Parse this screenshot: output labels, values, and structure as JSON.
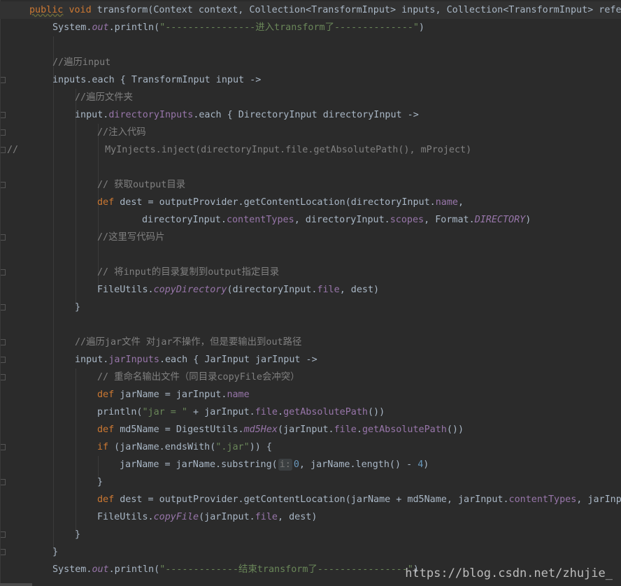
{
  "editor": {
    "lines": {
      "l0": {
        "kw1": "public",
        "kw2": "void",
        "rest": " transform(Context context, Collection<TransformInput> inputs, Collection<TransformInput> refer"
      },
      "l1": {
        "a": "System.",
        "b": "out",
        "c": ".println(",
        "d": "\"----------------进入transform了--------------\"",
        "e": ")"
      },
      "l3": {
        "c": "//遍历input"
      },
      "l4": {
        "a": "inputs.each { TransformInput input ->"
      },
      "l5": {
        "c": "//遍历文件夹"
      },
      "l6": {
        "a": "input.",
        "b": "directoryInputs",
        "c": ".each { DirectoryInput directoryInput ->"
      },
      "l7": {
        "c": "//注入代码"
      },
      "l8": {
        "g": "//",
        "c": "MyInjects.inject(directoryInput.file.getAbsolutePath(), mProject)"
      },
      "l10": {
        "c": "// 获取output目录"
      },
      "l11": {
        "kw": "def",
        "a": " dest = outputProvider.getContentLocation(directoryInput.",
        "b": "name",
        "c": ","
      },
      "l12": {
        "a": "directoryInput.",
        "b": "contentTypes",
        "c": ", directoryInput.",
        "d": "scopes",
        "e": ", Format.",
        "f": "DIRECTORY",
        "g": ")"
      },
      "l13": {
        "c": "//这里写代码片"
      },
      "l15": {
        "c": "// 将input的目录复制到output指定目录"
      },
      "l16": {
        "a": "FileUtils.",
        "b": "copyDirectory",
        "c": "(directoryInput.",
        "d": "file",
        "e": ", dest)"
      },
      "l17": {
        "a": "}"
      },
      "l19": {
        "c": "//遍历jar文件 对jar不操作，但是要输出到out路径"
      },
      "l20": {
        "a": "input.",
        "b": "jarInputs",
        "c": ".each { JarInput jarInput ->"
      },
      "l21": {
        "c": "// 重命名输出文件（同目录copyFile会冲突）"
      },
      "l22": {
        "kw": "def",
        "a": " jarName = jarInput.",
        "b": "name"
      },
      "l23": {
        "a": "println(",
        "s": "\"jar = \"",
        "b": " + jarInput.",
        "p": "file",
        "c": ".",
        "d": "getAbsolutePath",
        "e": "())"
      },
      "l24": {
        "kw": "def",
        "a": " md5Name = DigestUtils.",
        "b": "md5Hex",
        "c": "(jarInput.",
        "p": "file",
        "d": ".",
        "e": "getAbsolutePath",
        "f": "())"
      },
      "l25": {
        "kw": "if",
        "a": " (jarName.endsWith(",
        "s": "\".jar\"",
        "b": ")) {"
      },
      "l26": {
        "a": "jarName = jarName.substring(",
        "h": "i:",
        "n": "0",
        "b": ", jarName.length() - ",
        "n2": "4",
        "c": ")"
      },
      "l27": {
        "a": "}"
      },
      "l28": {
        "kw": "def",
        "a": " dest = outputProvider.getContentLocation(jarName + md5Name, jarInput.",
        "b": "contentTypes",
        "c": ", jarInpu"
      },
      "l29": {
        "a": "FileUtils.",
        "b": "copyFile",
        "c": "(jarInput.",
        "d": "file",
        "e": ", dest)"
      },
      "l30": {
        "a": "}"
      },
      "l31": {
        "a": "}"
      },
      "l32": {
        "a": "System.",
        "b": "out",
        "c": ".println(",
        "d": "\"-------------结束transform了----------------\"",
        "e": ")"
      }
    }
  },
  "watermark": "https://blog.csdn.net/zhujie_",
  "colors": {
    "background": "#2b2b2b",
    "keyword": "#cc7832",
    "string": "#6a8759",
    "comment": "#808080",
    "property": "#9876aa",
    "number": "#6897bb"
  }
}
